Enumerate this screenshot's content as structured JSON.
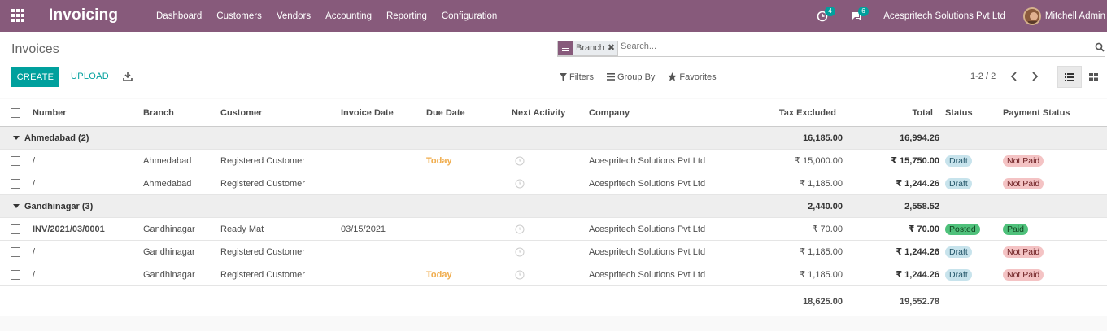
{
  "nav": {
    "app_title": "Invoicing",
    "menu": [
      "Dashboard",
      "Customers",
      "Vendors",
      "Accounting",
      "Reporting",
      "Configuration"
    ],
    "activity_count": "4",
    "messages_count": "6",
    "company": "Acespritech Solutions Pvt Ltd",
    "user": "Mitchell Admin"
  },
  "control_panel": {
    "breadcrumb": "Invoices",
    "create_label": "CREATE",
    "upload_label": "UPLOAD",
    "facet_label": "Branch",
    "search_placeholder": "Search...",
    "filters_label": "Filters",
    "groupby_label": "Group By",
    "favorites_label": "Favorites",
    "pager": "1-2 / 2"
  },
  "table": {
    "columns": [
      "Number",
      "Branch",
      "Customer",
      "Invoice Date",
      "Due Date",
      "Next Activity",
      "Company",
      "Tax Excluded",
      "Total",
      "Status",
      "Payment Status"
    ],
    "groups": [
      {
        "label": "Ahmedabad (2)",
        "tax_excluded": "16,185.00",
        "total": "16,994.26",
        "rows": [
          {
            "number": "/",
            "branch": "Ahmedabad",
            "customer": "Registered Customer",
            "invoice_date": "",
            "due_date": "Today",
            "company": "Acespritech Solutions Pvt Ltd",
            "tax_excluded": "₹ 15,000.00",
            "total": "₹ 15,750.00",
            "status": "Draft",
            "payment_status": "Not Paid"
          },
          {
            "number": "/",
            "branch": "Ahmedabad",
            "customer": "Registered Customer",
            "invoice_date": "",
            "due_date": "",
            "company": "Acespritech Solutions Pvt Ltd",
            "tax_excluded": "₹ 1,185.00",
            "total": "₹ 1,244.26",
            "status": "Draft",
            "payment_status": "Not Paid"
          }
        ]
      },
      {
        "label": "Gandhinagar (3)",
        "tax_excluded": "2,440.00",
        "total": "2,558.52",
        "rows": [
          {
            "number": "INV/2021/03/0001",
            "branch": "Gandhinagar",
            "customer": "Ready Mat",
            "invoice_date": "03/15/2021",
            "due_date": "",
            "company": "Acespritech Solutions Pvt Ltd",
            "tax_excluded": "₹ 70.00",
            "total": "₹ 70.00",
            "status": "Posted",
            "payment_status": "Paid"
          },
          {
            "number": "/",
            "branch": "Gandhinagar",
            "customer": "Registered Customer",
            "invoice_date": "",
            "due_date": "",
            "company": "Acespritech Solutions Pvt Ltd",
            "tax_excluded": "₹ 1,185.00",
            "total": "₹ 1,244.26",
            "status": "Draft",
            "payment_status": "Not Paid"
          },
          {
            "number": "/",
            "branch": "Gandhinagar",
            "customer": "Registered Customer",
            "invoice_date": "",
            "due_date": "Today",
            "company": "Acespritech Solutions Pvt Ltd",
            "tax_excluded": "₹ 1,185.00",
            "total": "₹ 1,244.26",
            "status": "Draft",
            "payment_status": "Not Paid"
          }
        ]
      }
    ],
    "footer": {
      "tax_excluded": "18,625.00",
      "total": "19,552.78"
    }
  },
  "colors": {
    "brand": "#875a7b",
    "primary": "#00a09d",
    "warning": "#f0ad4e"
  }
}
